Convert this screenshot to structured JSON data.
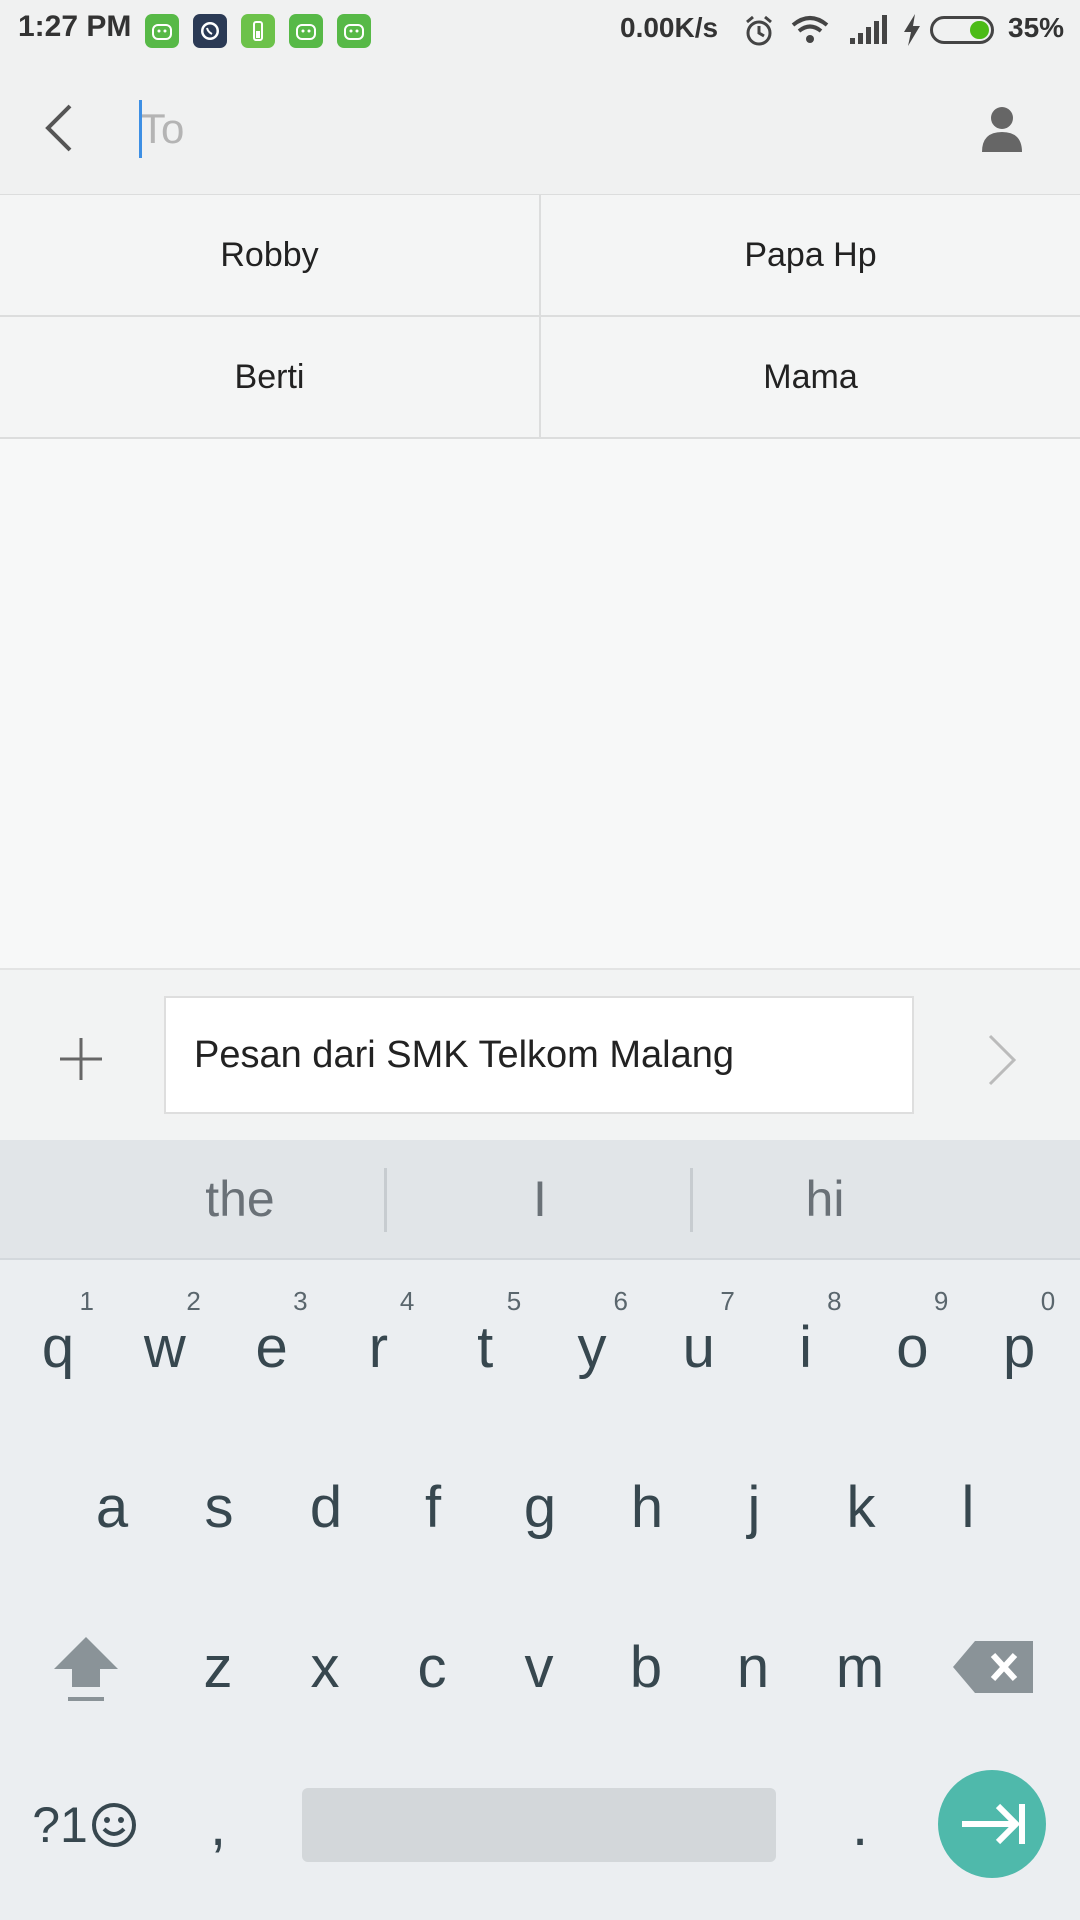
{
  "status_bar": {
    "time": "1:27 PM",
    "net_speed": "0.00K/s",
    "battery_percent": "35%",
    "battery_level": 0.35,
    "battery_color": "#4cbb17"
  },
  "header": {
    "to_placeholder": "To",
    "to_value": ""
  },
  "suggested_contacts": [
    "Robby",
    "Papa Hp",
    "Berti",
    "Mama"
  ],
  "compose": {
    "message": "Pesan dari SMK Telkom Malang"
  },
  "keyboard": {
    "suggestions": [
      "the",
      "I",
      "hi"
    ],
    "row1": [
      {
        "k": "q",
        "hint": "1"
      },
      {
        "k": "w",
        "hint": "2"
      },
      {
        "k": "e",
        "hint": "3"
      },
      {
        "k": "r",
        "hint": "4"
      },
      {
        "k": "t",
        "hint": "5"
      },
      {
        "k": "y",
        "hint": "6"
      },
      {
        "k": "u",
        "hint": "7"
      },
      {
        "k": "i",
        "hint": "8"
      },
      {
        "k": "o",
        "hint": "9"
      },
      {
        "k": "p",
        "hint": "0"
      }
    ],
    "row2": [
      "a",
      "s",
      "d",
      "f",
      "g",
      "h",
      "j",
      "k",
      "l"
    ],
    "row3": [
      "z",
      "x",
      "c",
      "v",
      "b",
      "n",
      "m"
    ],
    "symbols_label": "?1",
    "comma": ",",
    "period": ".",
    "accent_color": "#4fb9ab"
  }
}
